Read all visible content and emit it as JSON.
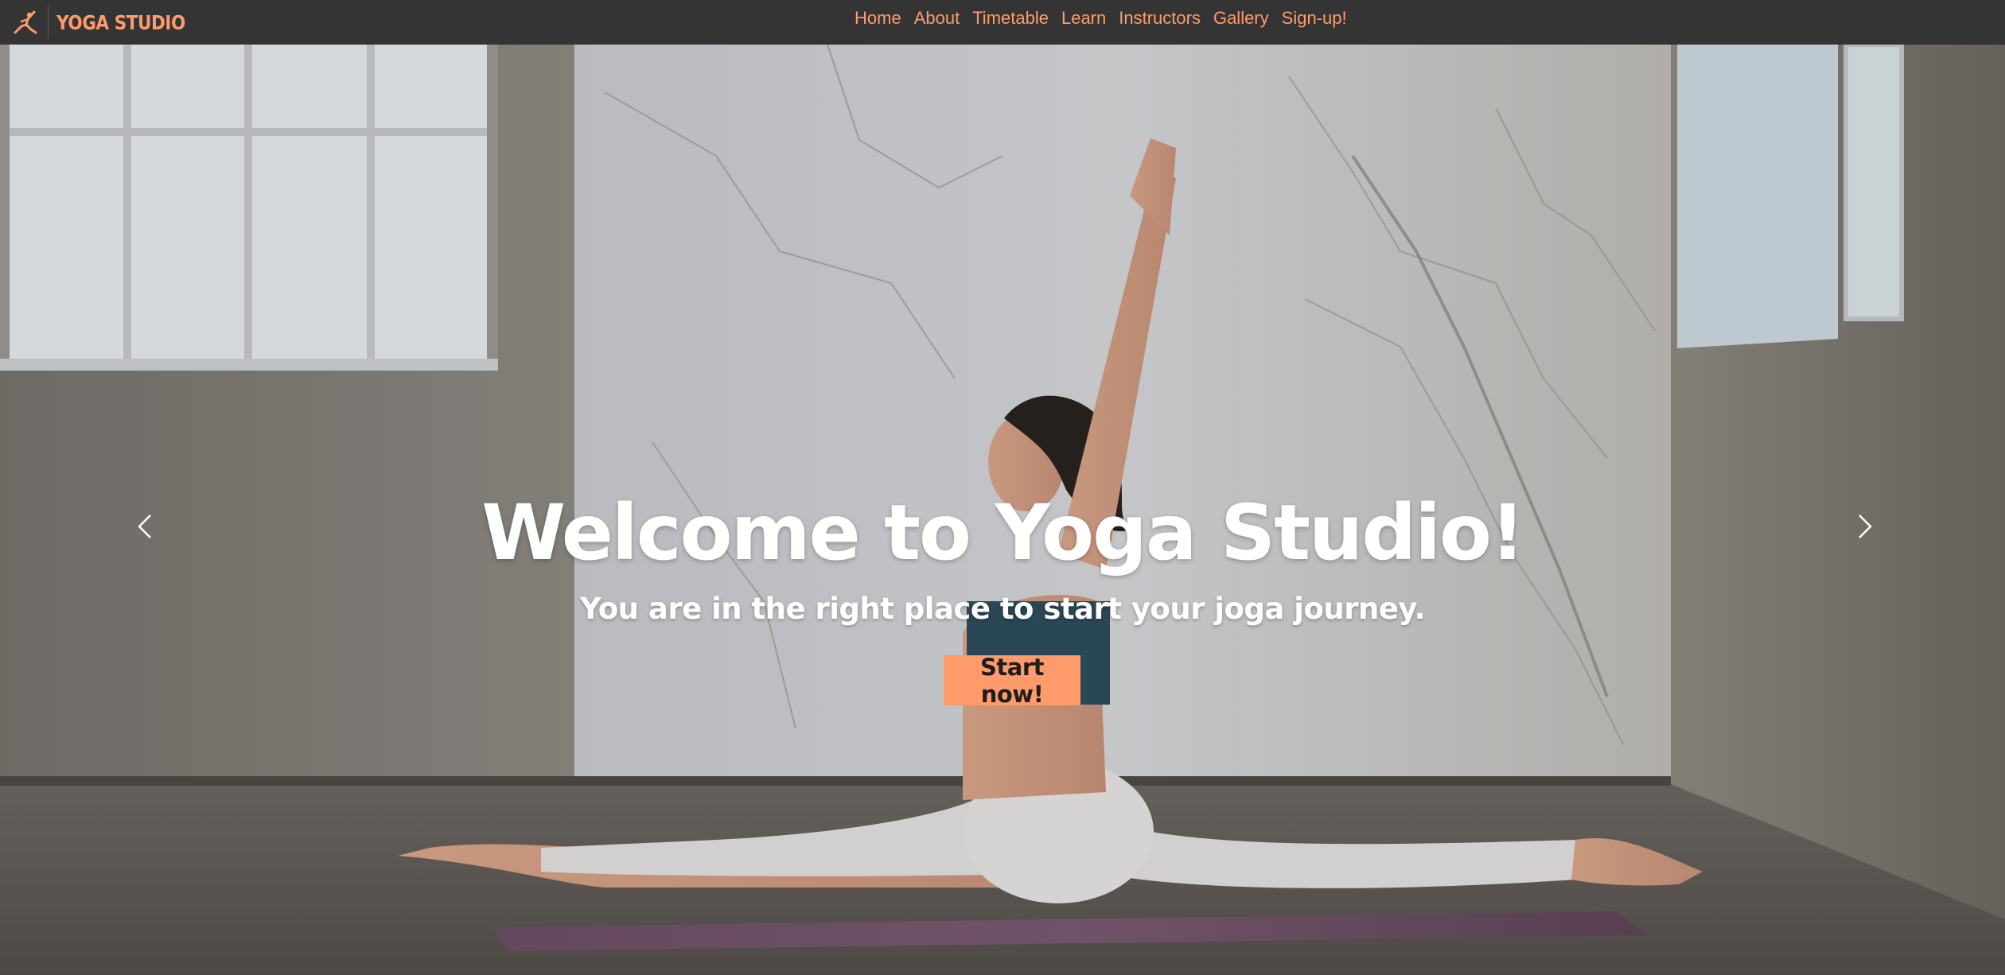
{
  "brand": {
    "name": "YOGA STUDIO",
    "logo_icon": "yoga-pose-icon",
    "color": "#ff9b6b"
  },
  "nav": {
    "items": [
      {
        "label": "Home"
      },
      {
        "label": "About"
      },
      {
        "label": "Timetable"
      },
      {
        "label": "Learn"
      },
      {
        "label": "Instructors"
      },
      {
        "label": "Gallery"
      },
      {
        "label": "Sign-up!"
      }
    ]
  },
  "hero": {
    "title": "Welcome to Yoga Studio!",
    "subtitle": "You are in the right place to start your joga journey.",
    "cta_label": "Start now!",
    "prev_icon": "chevron-left-icon",
    "next_icon": "chevron-right-icon",
    "slide_count": 3,
    "active_slide": 1
  },
  "colors": {
    "accent": "#ff9b6b",
    "navbar": "#343434"
  }
}
